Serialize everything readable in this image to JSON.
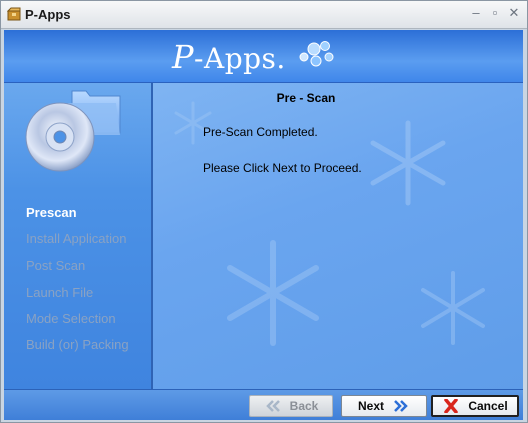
{
  "window": {
    "title": "P-Apps"
  },
  "banner": {
    "logo_initial": "P",
    "logo_rest": "-Apps."
  },
  "icons": {
    "app": "package-icon",
    "minimize": "minimize-icon",
    "maximize": "maximize-icon",
    "close": "close-icon",
    "disc": "disc-folder-icon",
    "back": "back-arrows-icon",
    "next": "next-arrows-icon",
    "cancel": "red-x-icon"
  },
  "sidebar": {
    "steps": [
      {
        "label": "Prescan",
        "state": "active"
      },
      {
        "label": "Install Application",
        "state": "inactive"
      },
      {
        "label": "Post Scan",
        "state": "inactive"
      },
      {
        "label": "Launch File",
        "state": "inactive"
      },
      {
        "label": "Mode Selection",
        "state": "inactive"
      },
      {
        "label": "Build (or) Packing",
        "state": "inactive"
      }
    ]
  },
  "content": {
    "title": "Pre - Scan",
    "message_1": "Pre-Scan Completed.",
    "message_2": "Please Click Next to Proceed."
  },
  "footer": {
    "back_label": "Back",
    "next_label": "Next",
    "cancel_label": "Cancel"
  },
  "colors": {
    "banner_blue": "#3f86ea",
    "sidebar_blue": "#4c92e6",
    "content_blue": "#6aa5ef",
    "inactive_step": "#8aa2c3",
    "cancel_x": "#d9261c"
  }
}
